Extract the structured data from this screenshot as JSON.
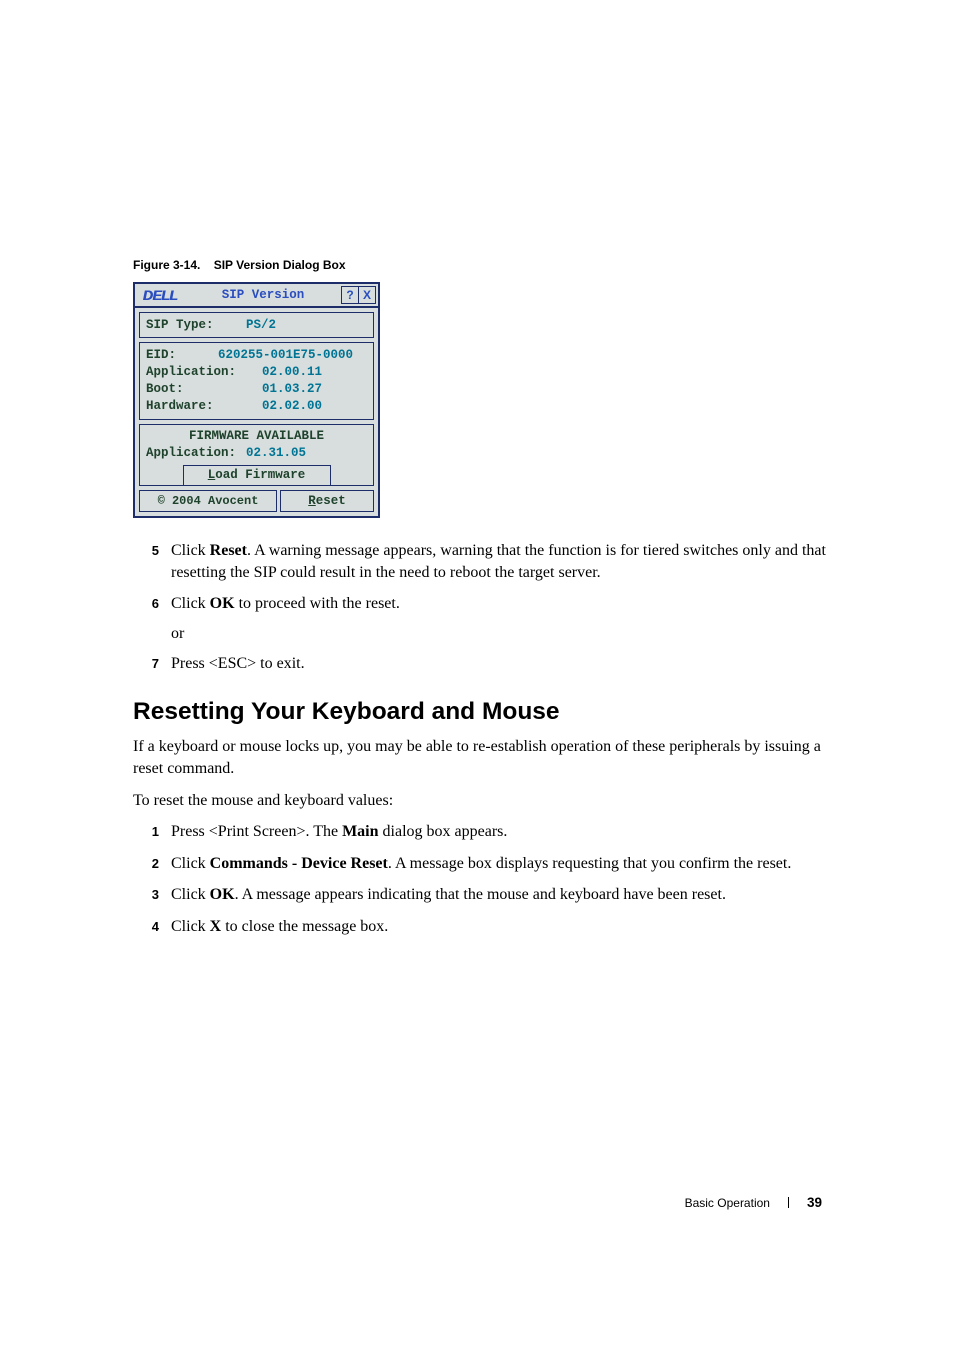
{
  "figure": {
    "caption_prefix": "Figure 3-14.",
    "caption_title": "SIP Version Dialog Box"
  },
  "dialog": {
    "logo_text": "DELL",
    "title": "SIP Version",
    "help_btn": "?",
    "close_btn": "X",
    "sip_type_label": "SIP Type:",
    "sip_type_value": "PS/2",
    "info": {
      "eid_label": "EID:",
      "eid_value": "620255-001E75-0000",
      "app_label": "Application:",
      "app_value": "02.00.11",
      "boot_label": "Boot:",
      "boot_value": "01.03.27",
      "hw_label": "Hardware:",
      "hw_value": "02.02.00"
    },
    "fw": {
      "heading": "FIRMWARE AVAILABLE",
      "app_label": "Application:",
      "app_value": "02.31.05",
      "load_btn_u": "L",
      "load_btn_rest": "oad Firmware"
    },
    "copyright": "© 2004 Avocent",
    "reset_btn_u": "R",
    "reset_btn_rest": "eset"
  },
  "steps_a": {
    "s5": {
      "num": "5",
      "t1": "Click ",
      "b1": "Reset",
      "t2": ". A warning message appears, warning that the function is for tiered switches only and that resetting the SIP could result in the need to reboot the target server."
    },
    "s6": {
      "num": "6",
      "t1": "Click ",
      "b1": "OK",
      "t2": " to proceed with the reset."
    },
    "or_text": "or",
    "s7": {
      "num": "7",
      "t1": "Press <ESC> to exit."
    }
  },
  "section_heading": "Resetting Your Keyboard and Mouse",
  "para1": "If a keyboard or mouse locks up, you may be able to re-establish operation of these peripherals by issuing a reset command.",
  "para2": "To reset the mouse and keyboard values:",
  "steps_b": {
    "s1": {
      "num": "1",
      "t1": "Press <Print Screen>. The ",
      "b1": "Main",
      "t2": " dialog box appears."
    },
    "s2": {
      "num": "2",
      "t1": "Click ",
      "b1": "Commands - Device Reset",
      "t2": ". A message box displays requesting that you confirm the reset."
    },
    "s3": {
      "num": "3",
      "t1": "Click ",
      "b1": "OK",
      "t2": ". A message appears indicating that the mouse and keyboard have been reset."
    },
    "s4": {
      "num": "4",
      "t1": "Click ",
      "b1": "X",
      "t2": " to close the message box."
    }
  },
  "footer": {
    "section": "Basic Operation",
    "page": "39"
  }
}
